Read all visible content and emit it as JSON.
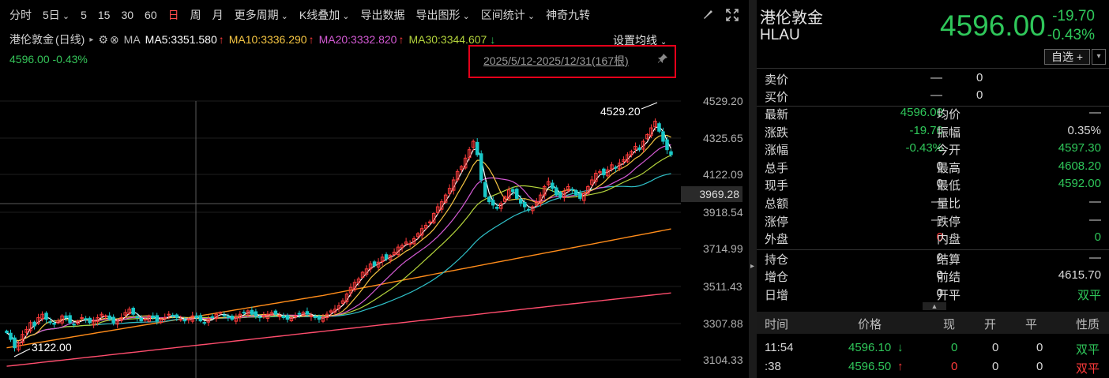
{
  "toolbar": {
    "items": [
      "分时",
      "5日",
      "5",
      "15",
      "30",
      "60",
      "日",
      "周",
      "月",
      "更多周期",
      "K线叠加",
      "导出数据",
      "导出图形",
      "区间统计",
      "神奇九转"
    ],
    "active_index": 6,
    "dropdown_indices": [
      1,
      9,
      10,
      12,
      13
    ]
  },
  "ma_line": {
    "name": "港伦敦金",
    "period": "(日线)",
    "ma_label": "MA",
    "ma5": "MA5:3351.580",
    "ma10": "MA10:3336.290",
    "ma20": "MA20:3332.820",
    "ma30": "MA30:3344.607",
    "set_ma": "设置均线"
  },
  "sub_info": "4596.00 -0.43%",
  "range": "2025/5/12-2025/12/31(167根)",
  "colors": {
    "up": "#ff3b3b",
    "down": "#19c8c8",
    "green": "#2fc75a",
    "ma5": "#ffffff",
    "ma10": "#f5c542",
    "ma20": "#d45ad4",
    "ma30": "#b4d43c",
    "ma60": "#2fc0c8",
    "ma120": "#ff8c1a",
    "ma250": "#ff4d6d"
  },
  "chart_data": {
    "type": "candlestick",
    "y_ticks": [
      "4529.20",
      "4325.65",
      "4122.09",
      "3918.54",
      "3714.99",
      "3511.43",
      "3307.88",
      "3104.33"
    ],
    "ylim": [
      3050,
      4620
    ],
    "crosshair_value": "3969.28",
    "high_label": "4529.20",
    "low_label": "3122.00",
    "closes": [
      3240,
      3200,
      3150,
      3180,
      3230,
      3260,
      3300,
      3280,
      3330,
      3350,
      3320,
      3300,
      3290,
      3310,
      3340,
      3330,
      3300,
      3290,
      3310,
      3330,
      3320,
      3300,
      3310,
      3330,
      3350,
      3340,
      3320,
      3300,
      3310,
      3330,
      3360,
      3380,
      3350,
      3330,
      3310,
      3320,
      3340,
      3330,
      3310,
      3320,
      3330,
      3350,
      3340,
      3330,
      3320,
      3310,
      3320,
      3340,
      3330,
      3310,
      3300,
      3320,
      3330,
      3350,
      3360,
      3340,
      3330,
      3320,
      3330,
      3350,
      3360,
      3370,
      3350,
      3340,
      3330,
      3340,
      3350,
      3360,
      3350,
      3340,
      3330,
      3320,
      3330,
      3340,
      3350,
      3360,
      3350,
      3340,
      3330,
      3320,
      3330,
      3350,
      3370,
      3380,
      3400,
      3430,
      3470,
      3510,
      3540,
      3560,
      3600,
      3620,
      3650,
      3640,
      3660,
      3690,
      3680,
      3700,
      3720,
      3750,
      3760,
      3780,
      3770,
      3800,
      3830,
      3860,
      3880,
      3900,
      3950,
      3990,
      4020,
      4060,
      4100,
      4150,
      4200,
      4230,
      4280,
      4330,
      4380,
      4300,
      4150,
      4050,
      4020,
      4000,
      3980,
      4010,
      4050,
      4090,
      4080,
      4040,
      4010,
      3990,
      3970,
      3990,
      4020,
      4060,
      4110,
      4140,
      4100,
      4060,
      4050,
      4080,
      4110,
      4090,
      4060,
      4040,
      4070,
      4110,
      4150,
      4190,
      4200,
      4180,
      4210,
      4240,
      4220,
      4250,
      4270,
      4300,
      4320,
      4350,
      4330,
      4380,
      4420,
      4460,
      4500,
      4440,
      4380,
      4330,
      4300
    ]
  },
  "quote": {
    "name": "港伦敦金",
    "code": "HLAU",
    "price": "4596.00",
    "change": "-19.70",
    "pct": "-0.43%",
    "watch_btn": "自选 +",
    "ask_label": "卖价",
    "ask_dash": "—",
    "ask_vol": "0",
    "bid_label": "买价",
    "bid_dash": "—",
    "bid_vol": "0",
    "rows": [
      {
        "l1": "最新",
        "v1": "4596.00",
        "c1": "g",
        "l2": "均价",
        "v2": "—",
        "c2": "w"
      },
      {
        "l1": "涨跌",
        "v1": "-19.70",
        "c1": "g",
        "l2": "振幅",
        "v2": "0.35%",
        "c2": "w"
      },
      {
        "l1": "涨幅",
        "v1": "-0.43%",
        "c1": "g",
        "l2": "今开",
        "v2": "4597.30",
        "c2": "g"
      },
      {
        "l1": "总手",
        "v1": "0",
        "c1": "w",
        "l2": "最高",
        "v2": "4608.20",
        "c2": "g"
      },
      {
        "l1": "现手",
        "v1": "0",
        "c1": "w",
        "l2": "最低",
        "v2": "4592.00",
        "c2": "g"
      },
      {
        "l1": "总额",
        "v1": "—",
        "c1": "w",
        "l2": "量比",
        "v2": "—",
        "c2": "w"
      },
      {
        "l1": "涨停",
        "v1": "—",
        "c1": "w",
        "l2": "跌停",
        "v2": "—",
        "c2": "w"
      },
      {
        "l1": "外盘",
        "v1": "0",
        "c1": "r",
        "l2": "内盘",
        "v2": "0",
        "c2": "g"
      },
      {
        "l1": "持仓",
        "v1": "0",
        "c1": "w",
        "l2": "结算",
        "v2": "—",
        "c2": "w"
      },
      {
        "l1": "增仓",
        "v1": "0",
        "c1": "w",
        "l2": "前结",
        "v2": "4615.70",
        "c2": "w"
      },
      {
        "l1": "日增",
        "v1": "0",
        "c1": "w",
        "l2": "开平",
        "v2": "双平",
        "c2": "g"
      }
    ]
  },
  "ticks": {
    "headers": [
      "时间",
      "价格",
      "现",
      "开",
      "平",
      "性质"
    ],
    "rows": [
      {
        "time": "11:54",
        "price": "4596.10",
        "dir": "down",
        "now": "0",
        "open": "0",
        "close": "0",
        "nature": "双平",
        "now_color": "g",
        "nature_color": "g"
      },
      {
        "time": ":38",
        "price": "4596.50",
        "dir": "up",
        "now": "0",
        "open": "0",
        "close": "0",
        "nature": "双平",
        "now_color": "r",
        "nature_color": "r"
      }
    ]
  }
}
